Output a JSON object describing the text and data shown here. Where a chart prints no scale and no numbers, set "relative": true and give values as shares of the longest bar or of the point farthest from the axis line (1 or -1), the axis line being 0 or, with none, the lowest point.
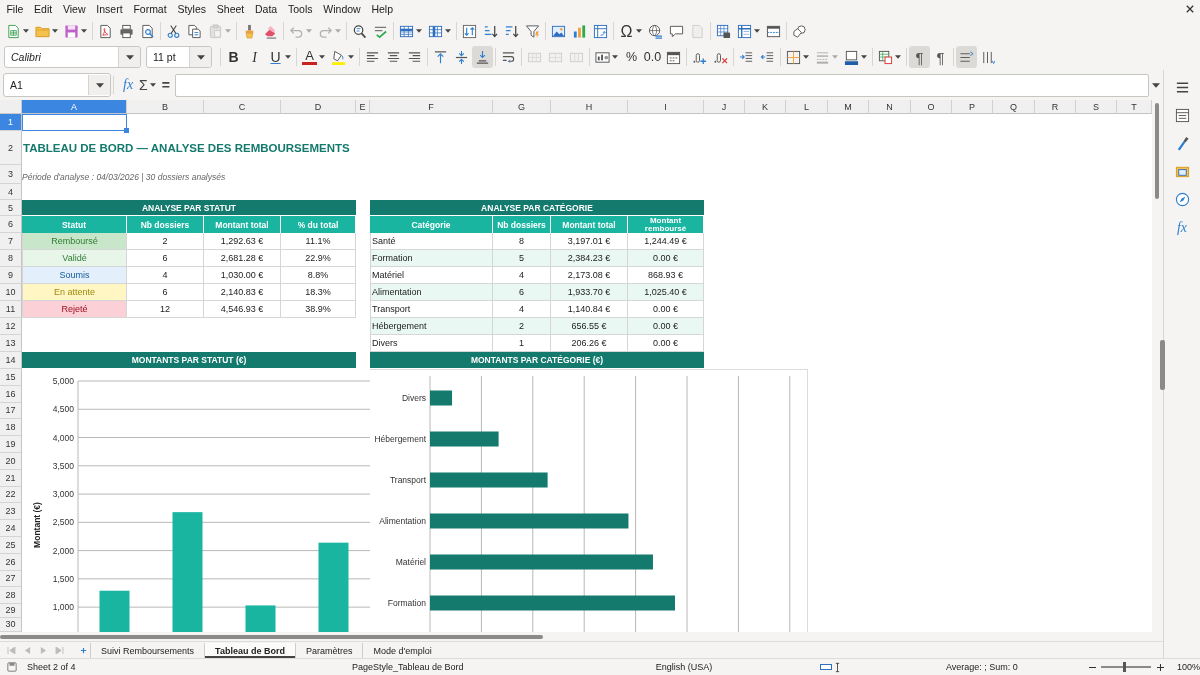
{
  "menu": [
    "File",
    "Edit",
    "View",
    "Insert",
    "Format",
    "Styles",
    "Sheet",
    "Data",
    "Tools",
    "Window",
    "Help"
  ],
  "standard_toolbar": {
    "paste": {
      "disabled": true
    },
    "undo": {
      "disabled": true
    },
    "redo": {
      "disabled": true
    },
    "special_character": {
      "glyph": "Ω"
    },
    "header_footer": {
      "disabled": true
    }
  },
  "formatting_toolbar": {
    "font_name": "Calibri",
    "font_size": "11 pt",
    "bold": {
      "glyph": "B"
    },
    "italic": {
      "glyph": "I"
    },
    "underline": {
      "glyph": "U"
    },
    "font_color": {
      "glyph": "A"
    },
    "align_left": {
      "selected": false
    },
    "align_center": {
      "selected": false
    },
    "align_right": {
      "selected": false
    },
    "align_top": {
      "selected": false
    },
    "align_middle": {
      "selected": false
    },
    "align_bottom": {
      "selected": true
    },
    "merge_and_center": {
      "disabled": true
    },
    "merge": {
      "disabled": true
    },
    "unmerge": {
      "disabled": true
    },
    "percent": {
      "glyph": "%"
    },
    "standard_format": {
      "glyph": "0.0"
    },
    "border_style": {
      "disabled": true
    },
    "left_to_right": {
      "glyph": "¶",
      "selected": true
    },
    "right_to_left": {
      "glyph": "¶",
      "selected": false
    },
    "text_horizontal": {
      "selected": true
    },
    "text_vertical": {
      "selected": false
    }
  },
  "formula_bar": {
    "name_box": "A1",
    "function_wizard": "fx",
    "sum": "Σ",
    "equals": "="
  },
  "sidebar": {
    "functions": "fx"
  },
  "sheet": {
    "columns": [
      {
        "label": "A",
        "selected": true
      },
      {
        "label": "B",
        "selected": false
      },
      {
        "label": "C",
        "selected": false
      },
      {
        "label": "D",
        "selected": false
      },
      {
        "label": "E",
        "selected": false
      },
      {
        "label": "F",
        "selected": false
      },
      {
        "label": "G",
        "selected": false
      },
      {
        "label": "H",
        "selected": false
      },
      {
        "label": "I",
        "selected": false
      },
      {
        "label": "J",
        "selected": false
      },
      {
        "label": "K",
        "selected": false
      },
      {
        "label": "L",
        "selected": false
      },
      {
        "label": "M",
        "selected": false
      },
      {
        "label": "N",
        "selected": false
      },
      {
        "label": "O",
        "selected": false
      },
      {
        "label": "P",
        "selected": false
      },
      {
        "label": "Q",
        "selected": false
      },
      {
        "label": "R",
        "selected": false
      },
      {
        "label": "S",
        "selected": false
      },
      {
        "label": "T",
        "selected": false
      }
    ],
    "rows": [
      {
        "label": "1",
        "selected": true
      },
      {
        "label": "2",
        "selected": false
      },
      {
        "label": "3",
        "selected": false
      },
      {
        "label": "4",
        "selected": false
      },
      {
        "label": "5",
        "selected": false
      },
      {
        "label": "6",
        "selected": false
      },
      {
        "label": "7",
        "selected": false
      },
      {
        "label": "8",
        "selected": false
      },
      {
        "label": "9",
        "selected": false
      },
      {
        "label": "10",
        "selected": false
      },
      {
        "label": "11",
        "selected": false
      },
      {
        "label": "12",
        "selected": false
      },
      {
        "label": "13",
        "selected": false
      },
      {
        "label": "14",
        "selected": false
      },
      {
        "label": "15",
        "selected": false
      },
      {
        "label": "16",
        "selected": false
      },
      {
        "label": "17",
        "selected": false
      },
      {
        "label": "18",
        "selected": false
      },
      {
        "label": "19",
        "selected": false
      },
      {
        "label": "20",
        "selected": false
      },
      {
        "label": "21",
        "selected": false
      },
      {
        "label": "22",
        "selected": false
      },
      {
        "label": "23",
        "selected": false
      },
      {
        "label": "24",
        "selected": false
      },
      {
        "label": "25",
        "selected": false
      },
      {
        "label": "26",
        "selected": false
      },
      {
        "label": "27",
        "selected": false
      },
      {
        "label": "28",
        "selected": false
      },
      {
        "label": "29",
        "selected": false
      },
      {
        "label": "30",
        "selected": false
      }
    ],
    "title": "TABLEAU DE BORD — ANALYSE DES REMBOURSEMENTS",
    "subtitle": "Période d'analyse : 04/03/2026 | 30 dossiers analysés",
    "status_table": {
      "title": "ANALYSE PAR STATUT",
      "headers": [
        "Statut",
        "Nb dossiers",
        "Montant total",
        "% du total"
      ],
      "rows": [
        {
          "status": "Remboursé",
          "color": "#c8e6c9",
          "count": "2",
          "amount": "1,292.63 €",
          "share": "11.1%"
        },
        {
          "status": "Validé",
          "color": "#e8f5e9",
          "count": "6",
          "amount": "2,681.28 €",
          "share": "22.9%"
        },
        {
          "status": "Soumis",
          "color": "#e3f0fc",
          "count": "4",
          "amount": "1,030.00 €",
          "share": "8.8%"
        },
        {
          "status": "En attente",
          "color": "#fff6c4",
          "count": "6",
          "amount": "2,140.83 €",
          "share": "18.3%"
        },
        {
          "status": "Rejeté",
          "color": "#fbd0d6",
          "count": "12",
          "amount": "4,546.93 €",
          "share": "38.9%"
        }
      ]
    },
    "category_table": {
      "title": "ANALYSE PAR CATÉGORIE",
      "headers": [
        "Catégorie",
        "Nb dossiers",
        "Montant total",
        "Montant remboursé"
      ],
      "rows": [
        {
          "category": "Santé",
          "count": "8",
          "amount": "3,197.01 €",
          "reimbursed": "1,244.49 €"
        },
        {
          "category": "Formation",
          "count": "5",
          "amount": "2,384.23 €",
          "reimbursed": "0.00 €"
        },
        {
          "category": "Matériel",
          "count": "4",
          "amount": "2,173.08 €",
          "reimbursed": "868.93 €"
        },
        {
          "category": "Alimentation",
          "count": "6",
          "amount": "1,933.70 €",
          "reimbursed": "1,025.40 €"
        },
        {
          "category": "Transport",
          "count": "4",
          "amount": "1,140.84 €",
          "reimbursed": "0.00 €"
        },
        {
          "category": "Hébergement",
          "count": "2",
          "amount": "656.55 €",
          "reimbursed": "0.00 €"
        },
        {
          "category": "Divers",
          "count": "1",
          "amount": "206.26 €",
          "reimbursed": "0.00 €"
        }
      ]
    },
    "status_chart": {
      "header": "MONTANTS PAR STATUT (€)",
      "chart_data": [
        {
          "type": "bar",
          "categories": [
            null,
            null,
            null,
            null
          ],
          "values": [
            1290,
            2680,
            1030,
            2140
          ],
          "color": "#19b5a1",
          "ylabel": "Montant (€)",
          "ylim": [
            560,
            5000
          ],
          "yticks": [
            {
              "value": 1000,
              "label": "1,000"
            },
            {
              "value": 1500,
              "label": "1,500"
            },
            {
              "value": 2000,
              "label": "2,000"
            },
            {
              "value": 2500,
              "label": "2,500"
            },
            {
              "value": 3000,
              "label": "3,000"
            },
            {
              "value": 3500,
              "label": "3,500"
            },
            {
              "value": 4000,
              "label": "4,000"
            },
            {
              "value": 4500,
              "label": "4,500"
            },
            {
              "value": 5000,
              "label": "5,000"
            }
          ],
          "grid": true
        }
      ]
    },
    "category_chart": {
      "header": "MONTANTS PAR CATÉGORIE (€)",
      "chart_data": [
        {
          "type": "bar",
          "orientation": "horizontal",
          "relative": true,
          "categories": [
            "Divers",
            "Hébergement",
            "Transport",
            "Alimentation",
            "Matériel",
            "Formation"
          ],
          "values": [
            0.09,
            0.28,
            0.48,
            0.81,
            0.91,
            1.0
          ],
          "color": "#137a6d",
          "grid": true
        }
      ]
    }
  },
  "sheet_tab_navigation": {
    "disabled": true
  },
  "sheet_tabs": [
    {
      "label": "Suivi Remboursements",
      "selected": false
    },
    {
      "label": "Tableau de Bord",
      "selected": true
    },
    {
      "label": "Paramètres",
      "selected": false
    },
    {
      "label": "Mode d'emploi",
      "selected": false
    }
  ],
  "status_bar": {
    "sheet": "Sheet 2 of 4",
    "page_style": "PageStyle_Tableau de Bord",
    "language": "English (USA)",
    "summary": "Average: ; Sum: 0",
    "zoom_slider": {
      "level": 0.45
    },
    "zoom": "100%"
  }
}
